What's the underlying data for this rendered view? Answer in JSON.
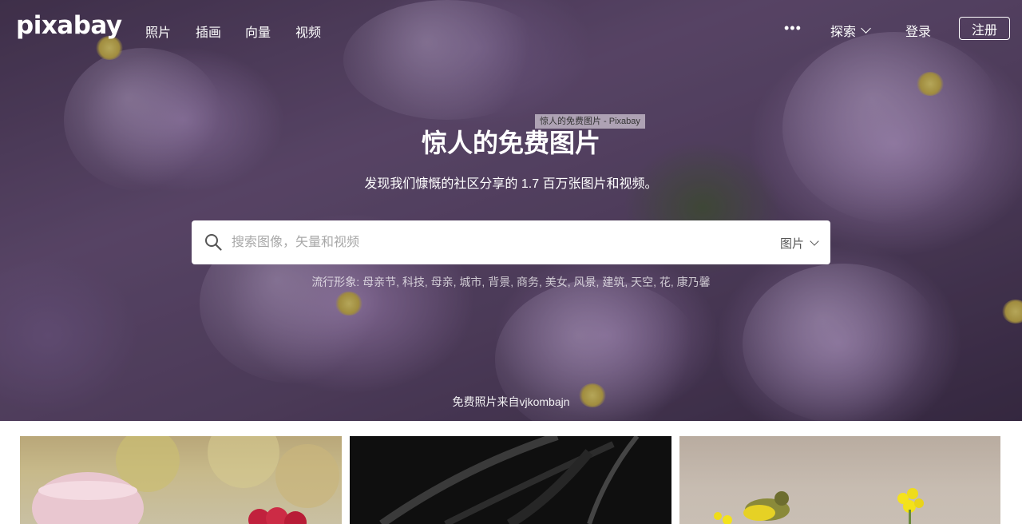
{
  "brand": {
    "logo_text": "pixabay"
  },
  "nav": {
    "links": [
      "照片",
      "插画",
      "向量",
      "视频"
    ],
    "more_label": "•••",
    "explore_label": "探索",
    "login_label": "登录",
    "signup_label": "注册"
  },
  "hero": {
    "tooltip": "惊人的免费图片 - Pixabay",
    "title": "惊人的免费图片",
    "subtitle": "发现我们慷慨的社区分享的 1.7 百万张图片和视频。",
    "search": {
      "placeholder": "搜索图像，矢量和视频",
      "type_label": "图片"
    },
    "trending_label": "流行形象:",
    "trending_terms": "母亲节, 科技, 母亲, 城市, 背景, 商务, 美女, 风景, 建筑, 天空, 花, 康乃馨",
    "credit": "免费照片来自vjkombajn"
  },
  "colors": {
    "hero_base": "#5a4766",
    "thumb_dark": "#0f0f0f"
  }
}
